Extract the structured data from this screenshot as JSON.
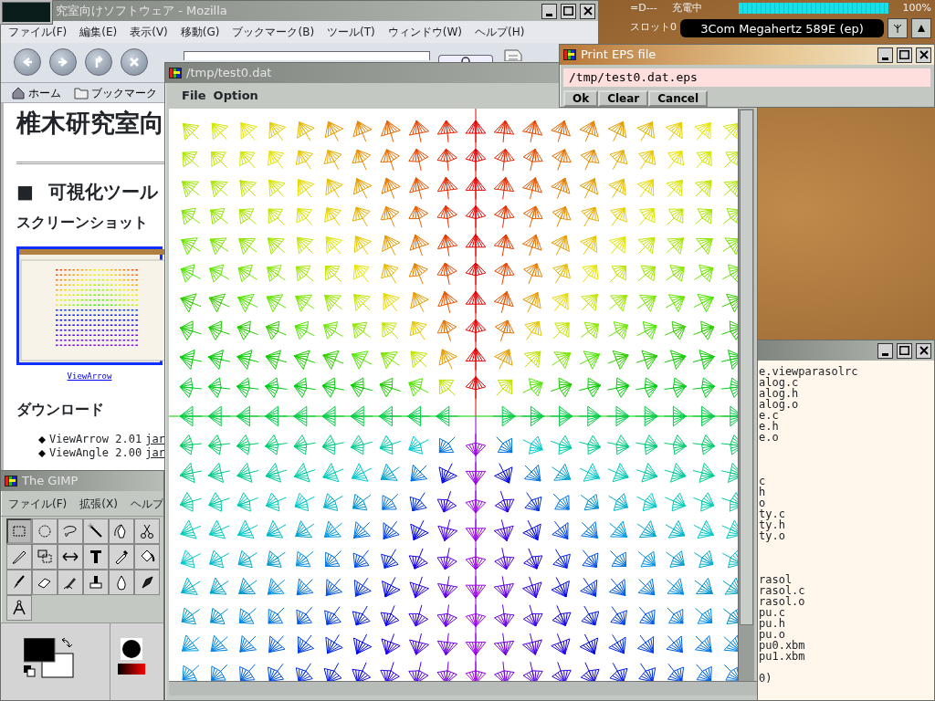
{
  "browser": {
    "title": "究室向けソフトウェア - Mozilla",
    "menu": [
      "ファイル(F)",
      "編集(E)",
      "表示(V)",
      "移動(G)",
      "ブックマーク(B)",
      "ツール(T)",
      "ウィンドウ(W)",
      "ヘルプ(H)"
    ],
    "personal_toolbar": [
      "ホーム",
      "ブックマーク"
    ],
    "page": {
      "heading": "椎木研究室向",
      "section_mark": "■",
      "section": "可視化ツール",
      "subheading": "スクリーンショット",
      "screenshot_caption": "ViewArrow",
      "downloads_heading": "ダウンロード",
      "downloads": [
        {
          "name": "ViewArrow 2.01",
          "link": "jar"
        },
        {
          "name": "ViewAngle 2.00",
          "link": "jar"
        }
      ]
    }
  },
  "viewer": {
    "title": "/tmp/test0.dat",
    "menu": [
      "File",
      "Option"
    ]
  },
  "print_dialog": {
    "title": "Print EPS file",
    "value": "/tmp/test0.dat.eps",
    "buttons": [
      "Ok",
      "Clear",
      "Cancel"
    ]
  },
  "pcmcia": {
    "status": "=D---",
    "charge": "充電中",
    "battery": {
      "level": 1,
      "reading": "100%"
    },
    "slot": "スロット0",
    "card": "3Com Megahertz 589E (ep)"
  },
  "terminal": {
    "blocks": [
      [
        "e.viewparasolrc",
        "alog.c",
        "alog.h",
        "alog.o",
        "e.c",
        "e.h",
        "e.o"
      ],
      [
        "c",
        "h",
        "o",
        "ty.c",
        "ty.h",
        "ty.o"
      ],
      [
        "rasol",
        "rasol.c",
        "rasol.o",
        "pu.c",
        "pu.h",
        "pu.o",
        "pu0.xbm",
        "pu1.xbm"
      ],
      [
        "0)"
      ]
    ]
  },
  "gimp": {
    "title": "The GIMP",
    "menu": [
      "ファイル(F)",
      "拡張(X)",
      "ヘルプ"
    ],
    "tools": [
      {
        "selected": true
      },
      {
        "selected": false
      },
      {
        "selected": false
      },
      {
        "selected": false
      },
      {
        "selected": false
      },
      {
        "selected": false
      },
      {
        "selected": false
      },
      {
        "selected": false
      },
      {
        "selected": false
      },
      {
        "selected": false
      },
      {
        "selected": false
      },
      {
        "selected": false
      },
      {
        "selected": false
      },
      {
        "selected": false
      },
      {
        "selected": false
      },
      {
        "selected": false
      },
      {
        "selected": false
      },
      {
        "selected": false
      },
      {
        "selected": false
      }
    ]
  }
}
